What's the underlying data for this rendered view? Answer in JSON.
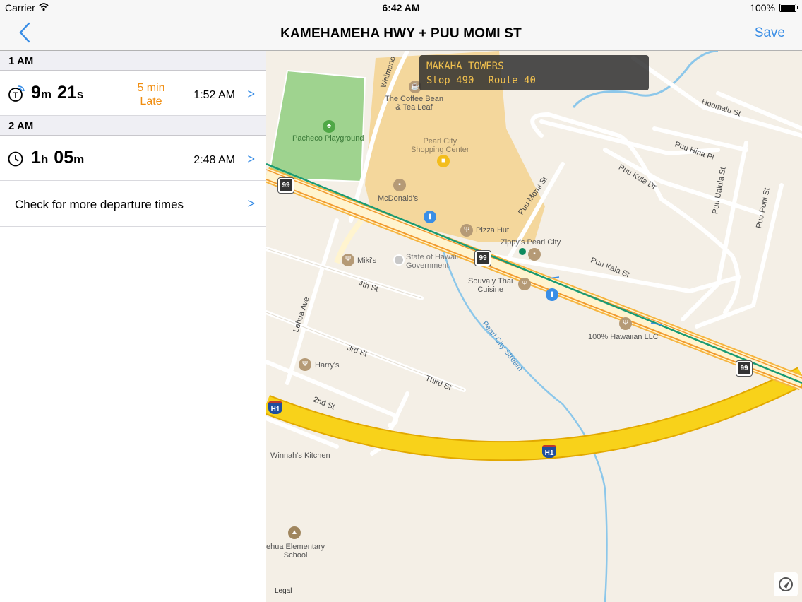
{
  "status_bar": {
    "carrier": "Carrier",
    "time": "6:42 AM",
    "battery": "100%"
  },
  "nav": {
    "title": "KAMEHAMEHA HWY + PUU MOMI ST",
    "save_label": "Save"
  },
  "sections": [
    {
      "header": "1 AM",
      "row": {
        "icon": "realtime-transit-icon",
        "dur_a": "9",
        "unit_a": "m",
        "dur_b": "21",
        "unit_b": "s",
        "status_1": "5 min",
        "status_2": "Late",
        "time": "1:52 AM"
      }
    },
    {
      "header": "2 AM",
      "row": {
        "icon": "clock-icon",
        "dur_a": "1",
        "unit_a": "h",
        "dur_b": "05",
        "unit_b": "m",
        "time": "2:48 AM"
      }
    }
  ],
  "more_label": "Check for more departure times",
  "callout": {
    "name": "MAKAHA TOWERS",
    "stop": "Stop 490",
    "route": "Route 40"
  },
  "map": {
    "places": {
      "coffee": "The Coffee Bean\n& Tea Leaf",
      "pacheco": "Pacheco Playground",
      "pearl_city": "Pearl City\nShopping Center",
      "mcdonalds": "McDonald's",
      "pizza_hut": "Pizza Hut",
      "zippys": "Zippy's Pearl City",
      "mikis": "Miki's",
      "state_gov": "State of Hawaii\nGovernment",
      "souvaly": "Souvaly Thai\nCuisine",
      "hawaiian": "100% Hawaiian LLC",
      "harrys": "Harry's",
      "winnah": "Winnah's Kitchen",
      "school": "ehua Elementary\nSchool"
    },
    "streets": {
      "waimano": "Waimano",
      "hoomalu": "Hoomalu St",
      "puu_hina": "Puu Hina Pl",
      "puu_kula": "Puu Kula Dr",
      "puu_ualu": "Puu Ualula St",
      "puu_poni": "Puu Poni St",
      "puu_momi": "Puu Momi St",
      "puu_kala": "Puu Kala St",
      "fourth": "4th St",
      "lehua": "Lehua Ave",
      "third_a": "3rd St",
      "third_b": "Third St",
      "second": "2nd St",
      "stream": "Pearl City Stream"
    },
    "shields": {
      "route99": "99",
      "h1": "H1"
    },
    "legal": "Legal",
    "colors": {
      "park": "#9fd38f",
      "mall": "#f4d79c",
      "highway": "#f8d21a",
      "route_line": "#1a9a73",
      "water": "#8cc7ea",
      "accent": "#3a8ee6",
      "late": "#f08d10"
    }
  }
}
